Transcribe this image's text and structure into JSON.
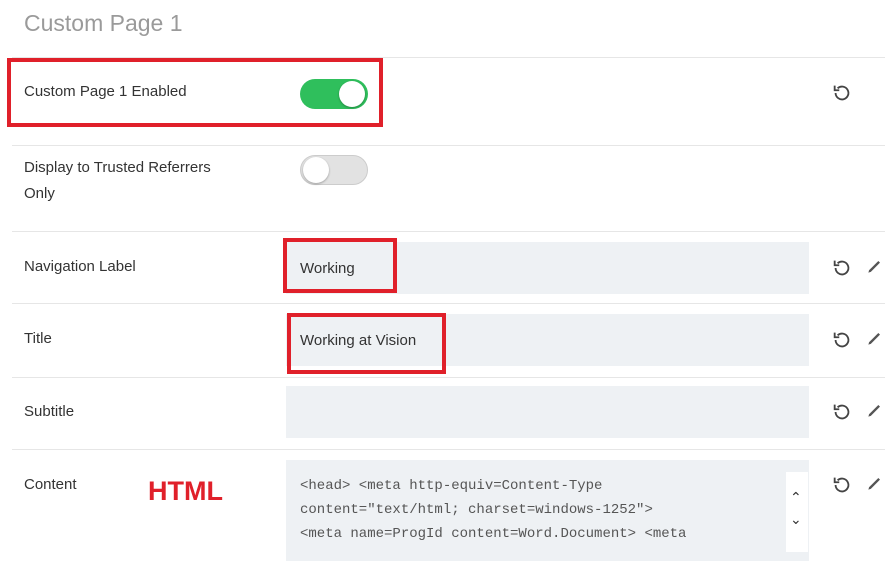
{
  "page": {
    "title": "Custom Page 1"
  },
  "fields": {
    "enabled": {
      "label": "Custom Page 1 Enabled",
      "state": "on"
    },
    "trusted": {
      "label_line1": "Display to Trusted Referrers",
      "label_line2": "Only",
      "state": "off"
    },
    "nav_label": {
      "label": "Navigation Label",
      "value": "Working"
    },
    "title": {
      "label": "Title",
      "value": "Working at Vision"
    },
    "subtitle": {
      "label": "Subtitle",
      "value": ""
    },
    "content": {
      "label": "Content",
      "lines": [
        "<head> <meta http-equiv=Content-Type",
        "content=\"text/html; charset=windows-1252\">",
        "<meta name=ProgId content=Word.Document> <meta"
      ]
    }
  },
  "annotation": {
    "html_label": "HTML"
  },
  "colors": {
    "toggle_on": "#2fbf5c",
    "highlight": "#e0202a",
    "field_bg": "#eef1f4"
  },
  "icons": {
    "reset": "reset-icon",
    "edit": "pencil-icon",
    "scroll_up": "chevron-up-icon",
    "scroll_down": "chevron-down-icon"
  }
}
